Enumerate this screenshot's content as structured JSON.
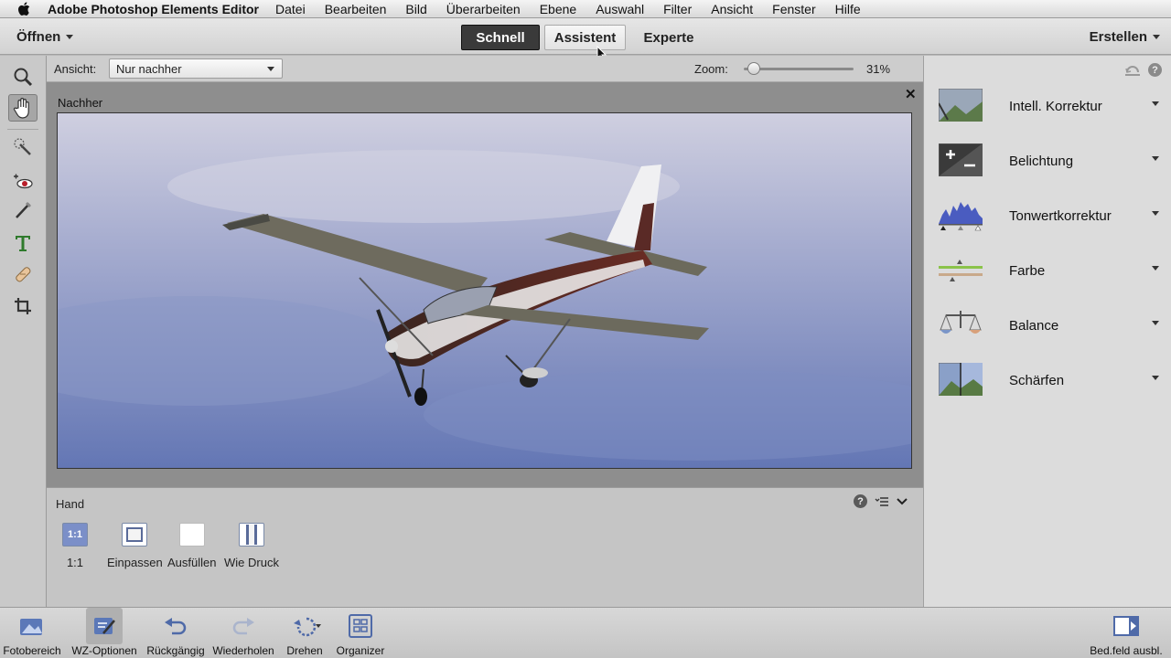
{
  "menubar": {
    "app_name": "Adobe Photoshop Elements Editor",
    "items": [
      "Datei",
      "Bearbeiten",
      "Bild",
      "Überarbeiten",
      "Ebene",
      "Auswahl",
      "Filter",
      "Ansicht",
      "Fenster",
      "Hilfe"
    ]
  },
  "modebar": {
    "open_label": "Öffnen",
    "tabs": [
      "Schnell",
      "Assistent",
      "Experte"
    ],
    "active_tab": "Schnell",
    "create_label": "Erstellen"
  },
  "toolbox": {
    "tools": [
      "zoom-tool-icon",
      "hand-tool-icon",
      "quick-selection-icon",
      "red-eye-icon",
      "whiten-teeth-icon",
      "text-tool-icon",
      "spot-healing-icon",
      "crop-tool-icon"
    ],
    "selected_tool": "hand-tool-icon"
  },
  "options": {
    "view_label": "Ansicht:",
    "view_value": "Nur nachher",
    "zoom_label": "Zoom:",
    "zoom_value": "31%",
    "zoom_fraction": 0.05
  },
  "document": {
    "label": "Nachher",
    "close": "✕"
  },
  "tool_options": {
    "title": "Hand",
    "buttons": [
      {
        "label": "1:1",
        "icon_text": "1:1"
      },
      {
        "label": "Einpassen"
      },
      {
        "label": "Ausfüllen"
      },
      {
        "label": "Wie Druck"
      }
    ],
    "help": "?"
  },
  "adjustments": {
    "items": [
      {
        "name": "Intell. Korrektur",
        "icon": "smart-fix-icon"
      },
      {
        "name": "Belichtung",
        "icon": "exposure-icon"
      },
      {
        "name": "Tonwertkorrektur",
        "icon": "levels-icon"
      },
      {
        "name": "Farbe",
        "icon": "color-icon"
      },
      {
        "name": "Balance",
        "icon": "balance-icon"
      },
      {
        "name": "Schärfen",
        "icon": "sharpen-icon"
      }
    ]
  },
  "bottombar": {
    "left": [
      "Fotobereich",
      "WZ-Optionen",
      "Rückgängig",
      "Wiederholen",
      "Drehen",
      "Organizer"
    ],
    "right": "Bed.feld ausbl."
  },
  "colors": {
    "active_tab_bg": "#3a3a3a",
    "sky_top": "#c8c8dc",
    "sky_bottom": "#6a7db8",
    "plane_body": "#5a2a22"
  }
}
